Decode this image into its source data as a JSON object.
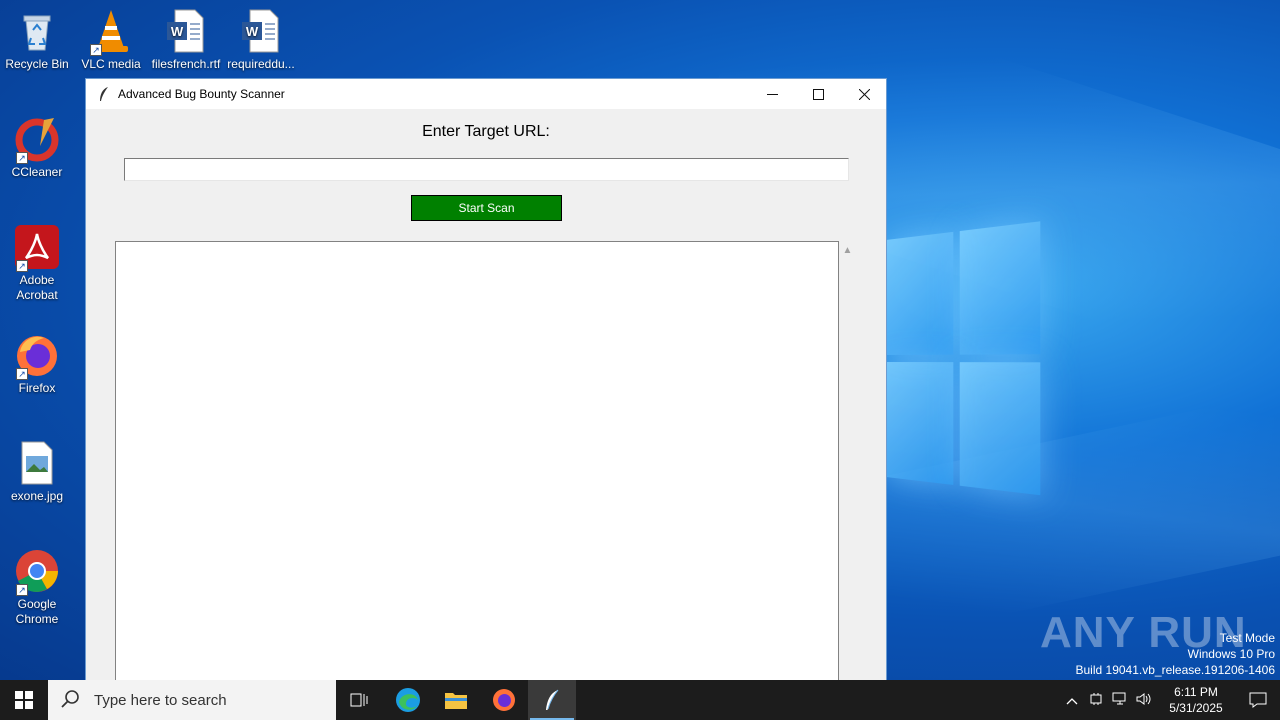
{
  "desktop": {
    "icons": [
      {
        "label": "Recycle Bin"
      },
      {
        "label": "VLC media"
      },
      {
        "label": "filesfrench.rtf"
      },
      {
        "label": "requireddu..."
      },
      {
        "label": "CCleaner"
      },
      {
        "label": "Adobe Acrobat"
      },
      {
        "label": "Firefox"
      },
      {
        "label": "exone.jpg"
      },
      {
        "label": "Google Chrome"
      }
    ]
  },
  "window": {
    "title": "Advanced Bug Bounty Scanner",
    "minimize_icon": "minimize-icon",
    "maximize_icon": "maximize-icon",
    "close_icon": "close-icon",
    "prompt_label": "Enter Target URL:",
    "url_value": "",
    "start_button_label": "Start Scan",
    "start_button_color": "#008000",
    "output_text": ""
  },
  "taskbar": {
    "search_placeholder": "Type here to search",
    "time": "6:11 PM",
    "date": "5/31/2025"
  },
  "watermark": {
    "brand": "ANY RUN",
    "line1": "Test Mode",
    "line2": "Windows 10 Pro",
    "line3": "Build 19041.vb_release.191206-1406"
  }
}
